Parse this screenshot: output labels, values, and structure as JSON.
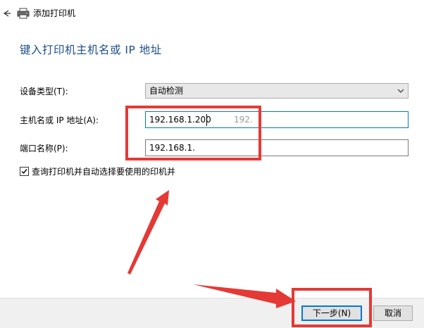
{
  "window": {
    "title": "添加打印机",
    "back_icon": "back-arrow-icon",
    "printer_icon": "printer-icon"
  },
  "page": {
    "title": "键入打印机主机名或 IP 地址"
  },
  "form": {
    "device_type": {
      "label": "设备类型(T):",
      "value": "自动检测"
    },
    "hostname": {
      "label": "主机名或 IP 地址(A):",
      "value": "192.168.1.200",
      "ghost": "192."
    },
    "port": {
      "label": "端口名称(P):",
      "value": "192.168.1."
    },
    "query_printer": {
      "label": "查询打印机并自动选择要使用的印机并",
      "checked": true
    }
  },
  "buttons": {
    "next": "下一步(N)",
    "cancel": "取消"
  },
  "colors": {
    "title_blue": "#1f4e8c",
    "focus_blue": "#0078d7",
    "annotation_red": "#e53935"
  }
}
